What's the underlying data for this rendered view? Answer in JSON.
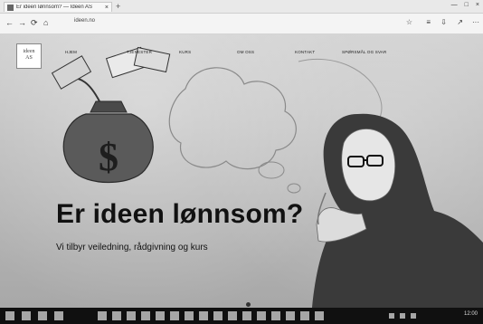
{
  "browser": {
    "tab_title": "Er ideen lønnsom? — Ideen AS",
    "tab_close": "×",
    "new_tab": "+",
    "window_controls": [
      "—",
      "□",
      "×"
    ],
    "nav": {
      "back": "←",
      "forward": "→",
      "refresh": "⟳",
      "home": "⌂"
    },
    "url": "ideen.no",
    "right_icons": [
      "☆",
      "≡",
      "⇩",
      "↗",
      "···"
    ]
  },
  "site": {
    "logo_text": [
      "ideen",
      "AS"
    ],
    "menu": [
      "HJEM",
      "TJENESTER",
      "KURS",
      "OM OSS",
      "KONTAKT",
      "SPØRSMÅL OG SVAR"
    ]
  },
  "hero": {
    "title": "Er ideen lønnsom?",
    "subtitle": "Vi tilbyr veiledning, rådgivning og kurs"
  },
  "taskbar": {
    "tray": "12:00"
  }
}
